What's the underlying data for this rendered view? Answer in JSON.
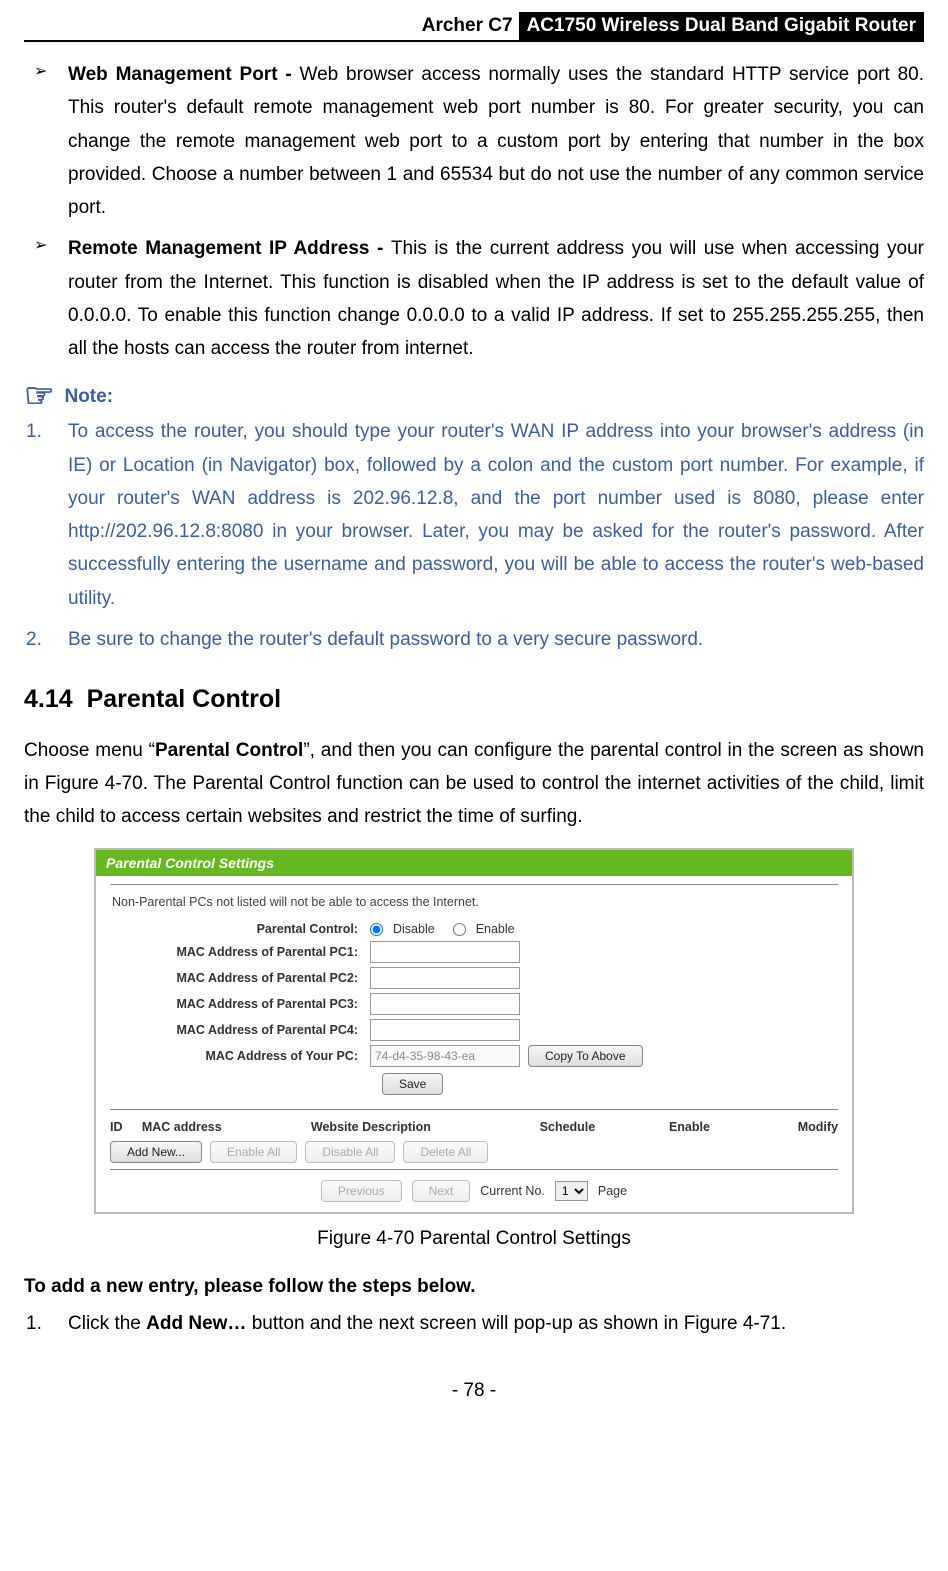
{
  "header": {
    "model": "Archer C7",
    "title": "AC1750 Wireless Dual Band Gigabit Router"
  },
  "bullets": [
    {
      "title": "Web Management Port - ",
      "body": "Web browser access normally uses the standard HTTP service port 80. This router's default remote management web port number is 80. For greater security, you can change the remote management web port to a custom port by entering that number in the box provided. Choose a number between 1 and 65534 but do not use the number of any common service port."
    },
    {
      "title": "Remote Management IP Address - ",
      "body": "This is the current address you will use when accessing your router from the Internet. This function is disabled when the IP address is set to the default value of 0.0.0.0. To enable this function change 0.0.0.0 to a valid IP address. If set to 255.255.255.255, then all the hosts can access the router from internet."
    }
  ],
  "note": {
    "label": "Note:",
    "items": [
      "To access the router, you should type your router's WAN IP address into your browser's address (in IE) or Location (in Navigator) box, followed by a colon and the custom port number. For example, if your router's WAN address is 202.96.12.8, and the port number used is 8080, please enter http://202.96.12.8:8080 in your browser. Later, you may be asked for the router's password. After successfully entering the username and password, you will be able to access the router's web-based utility.",
      "Be sure to change the router's default password to a very secure password."
    ]
  },
  "section": {
    "number": "4.14",
    "title": "Parental Control"
  },
  "intro": {
    "prefix": "Choose menu “",
    "menu": "Parental Control",
    "suffix": "”, and then you can configure the parental control in the screen as shown in Figure 4-70. The Parental Control function can be used to control the internet activities of the child, limit the child to access certain websites and restrict the time of surfing."
  },
  "screenshot": {
    "title": "Parental Control Settings",
    "note": "Non-Parental PCs not listed will not be able to access the Internet.",
    "rows": {
      "parental_control": "Parental Control:",
      "disable": "Disable",
      "enable": "Enable",
      "mac1": "MAC Address of Parental PC1:",
      "mac2": "MAC Address of Parental PC2:",
      "mac3": "MAC Address of Parental PC3:",
      "mac4": "MAC Address of Parental PC4:",
      "your_pc": "MAC Address of Your PC:",
      "your_pc_value": "74-d4-35-98-43-ea",
      "copy_btn": "Copy To Above",
      "save_btn": "Save"
    },
    "table": {
      "id": "ID",
      "mac": "MAC address",
      "desc": "Website Description",
      "sched": "Schedule",
      "enable": "Enable",
      "modify": "Modify"
    },
    "btns": {
      "add_new": "Add New...",
      "enable_all": "Enable All",
      "disable_all": "Disable All",
      "delete_all": "Delete All",
      "previous": "Previous",
      "next": "Next"
    },
    "pager": {
      "label": "Current No.",
      "value": "1",
      "suffix": "Page"
    }
  },
  "caption": "Figure 4-70 Parental Control Settings",
  "steps_intro": "To add a new entry, please follow the steps below.",
  "steps": [
    {
      "prefix": "Click the ",
      "bold": "Add New…",
      "suffix": " button and the next screen will pop-up as shown in Figure 4-71."
    }
  ],
  "page_number": "- 78 -"
}
